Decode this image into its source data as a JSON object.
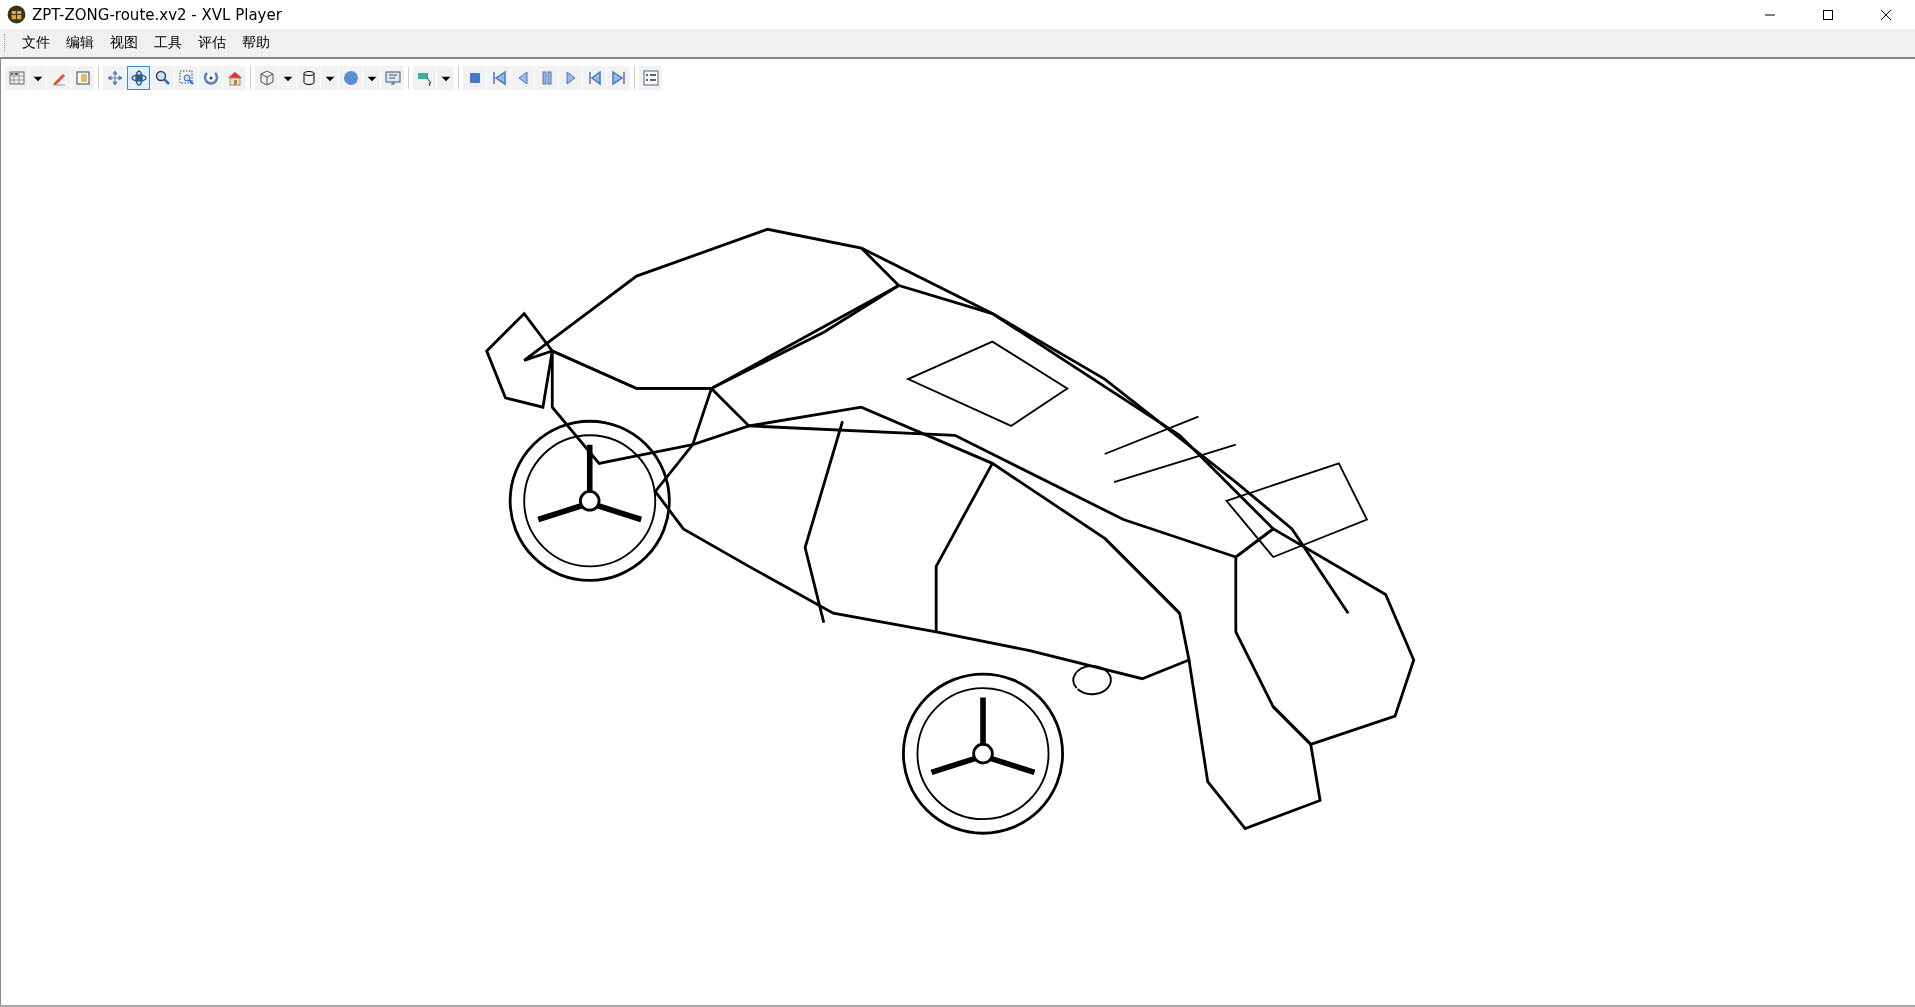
{
  "window": {
    "title": "ZPT-ZONG-route.xv2 - XVL Player"
  },
  "menu": [
    "文件",
    "编辑",
    "视图",
    "工具",
    "评估",
    "帮助"
  ],
  "toolbar": [
    {
      "selected": false
    },
    {
      "selected": false
    },
    {
      "selected": false
    },
    {
      "selected": false
    },
    {
      "selected": false
    },
    {
      "selected": true
    },
    {
      "selected": false
    },
    {
      "selected": false
    },
    {
      "selected": false
    },
    {
      "selected": false
    },
    {
      "selected": false
    },
    {
      "selected": false
    },
    {
      "selected": false
    },
    {
      "selected": false
    },
    {
      "selected": false
    },
    {
      "selected": false
    },
    {
      "selected": false
    },
    {
      "selected": false
    },
    {
      "selected": false
    },
    {
      "selected": false
    },
    {
      "selected": false
    },
    {
      "selected": false
    },
    {
      "selected": false
    },
    {
      "selected": false
    },
    {
      "selected": false
    },
    {
      "selected": false
    },
    {
      "selected": false
    }
  ]
}
